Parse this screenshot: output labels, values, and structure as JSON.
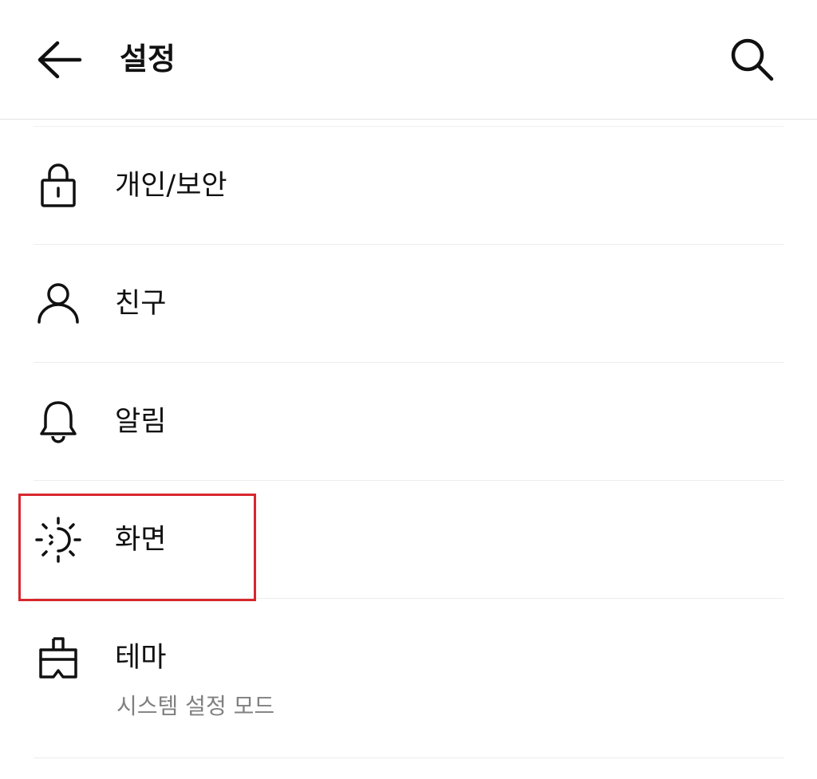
{
  "header": {
    "title": "설정",
    "back_icon": "arrow-left-icon",
    "search_icon": "search-icon"
  },
  "menu": {
    "items": [
      {
        "label": "개인/보안",
        "icon": "lock-icon"
      },
      {
        "label": "친구",
        "icon": "person-icon"
      },
      {
        "label": "알림",
        "icon": "bell-icon"
      },
      {
        "label": "화면",
        "icon": "brightness-icon"
      },
      {
        "label": "테마",
        "icon": "paint-brush-icon",
        "sublabel": "시스템 설정 모드"
      }
    ]
  },
  "highlight": {
    "color": "#d8262d",
    "target": "화면"
  },
  "colors": {
    "text": "#111111",
    "subtext": "#808080",
    "divider": "#ececec"
  }
}
